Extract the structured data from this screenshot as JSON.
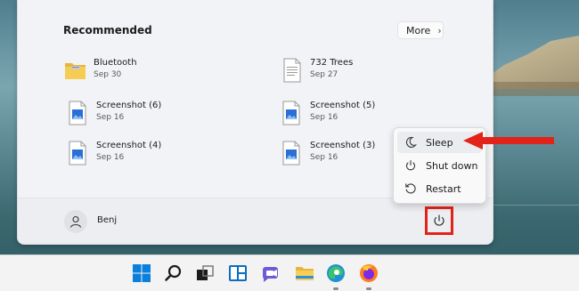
{
  "start_menu": {
    "recommended_title": "Recommended",
    "more_label": "More",
    "items": [
      {
        "name": "Bluetooth",
        "date": "Sep 30",
        "icon": "folder-icon"
      },
      {
        "name": "732 Trees",
        "date": "Sep 27",
        "icon": "document-icon"
      },
      {
        "name": "Screenshot (6)",
        "date": "Sep 16",
        "icon": "image-file-icon"
      },
      {
        "name": "Screenshot (5)",
        "date": "Sep 16",
        "icon": "image-file-icon"
      },
      {
        "name": "Screenshot (4)",
        "date": "Sep 16",
        "icon": "image-file-icon"
      },
      {
        "name": "Screenshot (3)",
        "date": "Sep 16",
        "icon": "image-file-icon"
      }
    ],
    "user_name": "Benj"
  },
  "power_menu": {
    "items": [
      {
        "label": "Sleep",
        "icon": "moon-icon",
        "highlighted": true
      },
      {
        "label": "Shut down",
        "icon": "power-icon"
      },
      {
        "label": "Restart",
        "icon": "restart-icon"
      }
    ]
  },
  "annotations": {
    "highlight_color": "#e2231a"
  },
  "taskbar": {
    "icons": [
      "windows-start-icon",
      "search-icon",
      "task-view-icon",
      "widgets-icon",
      "teams-chat-icon",
      "file-explorer-icon",
      "edge-icon",
      "firefox-icon"
    ]
  }
}
